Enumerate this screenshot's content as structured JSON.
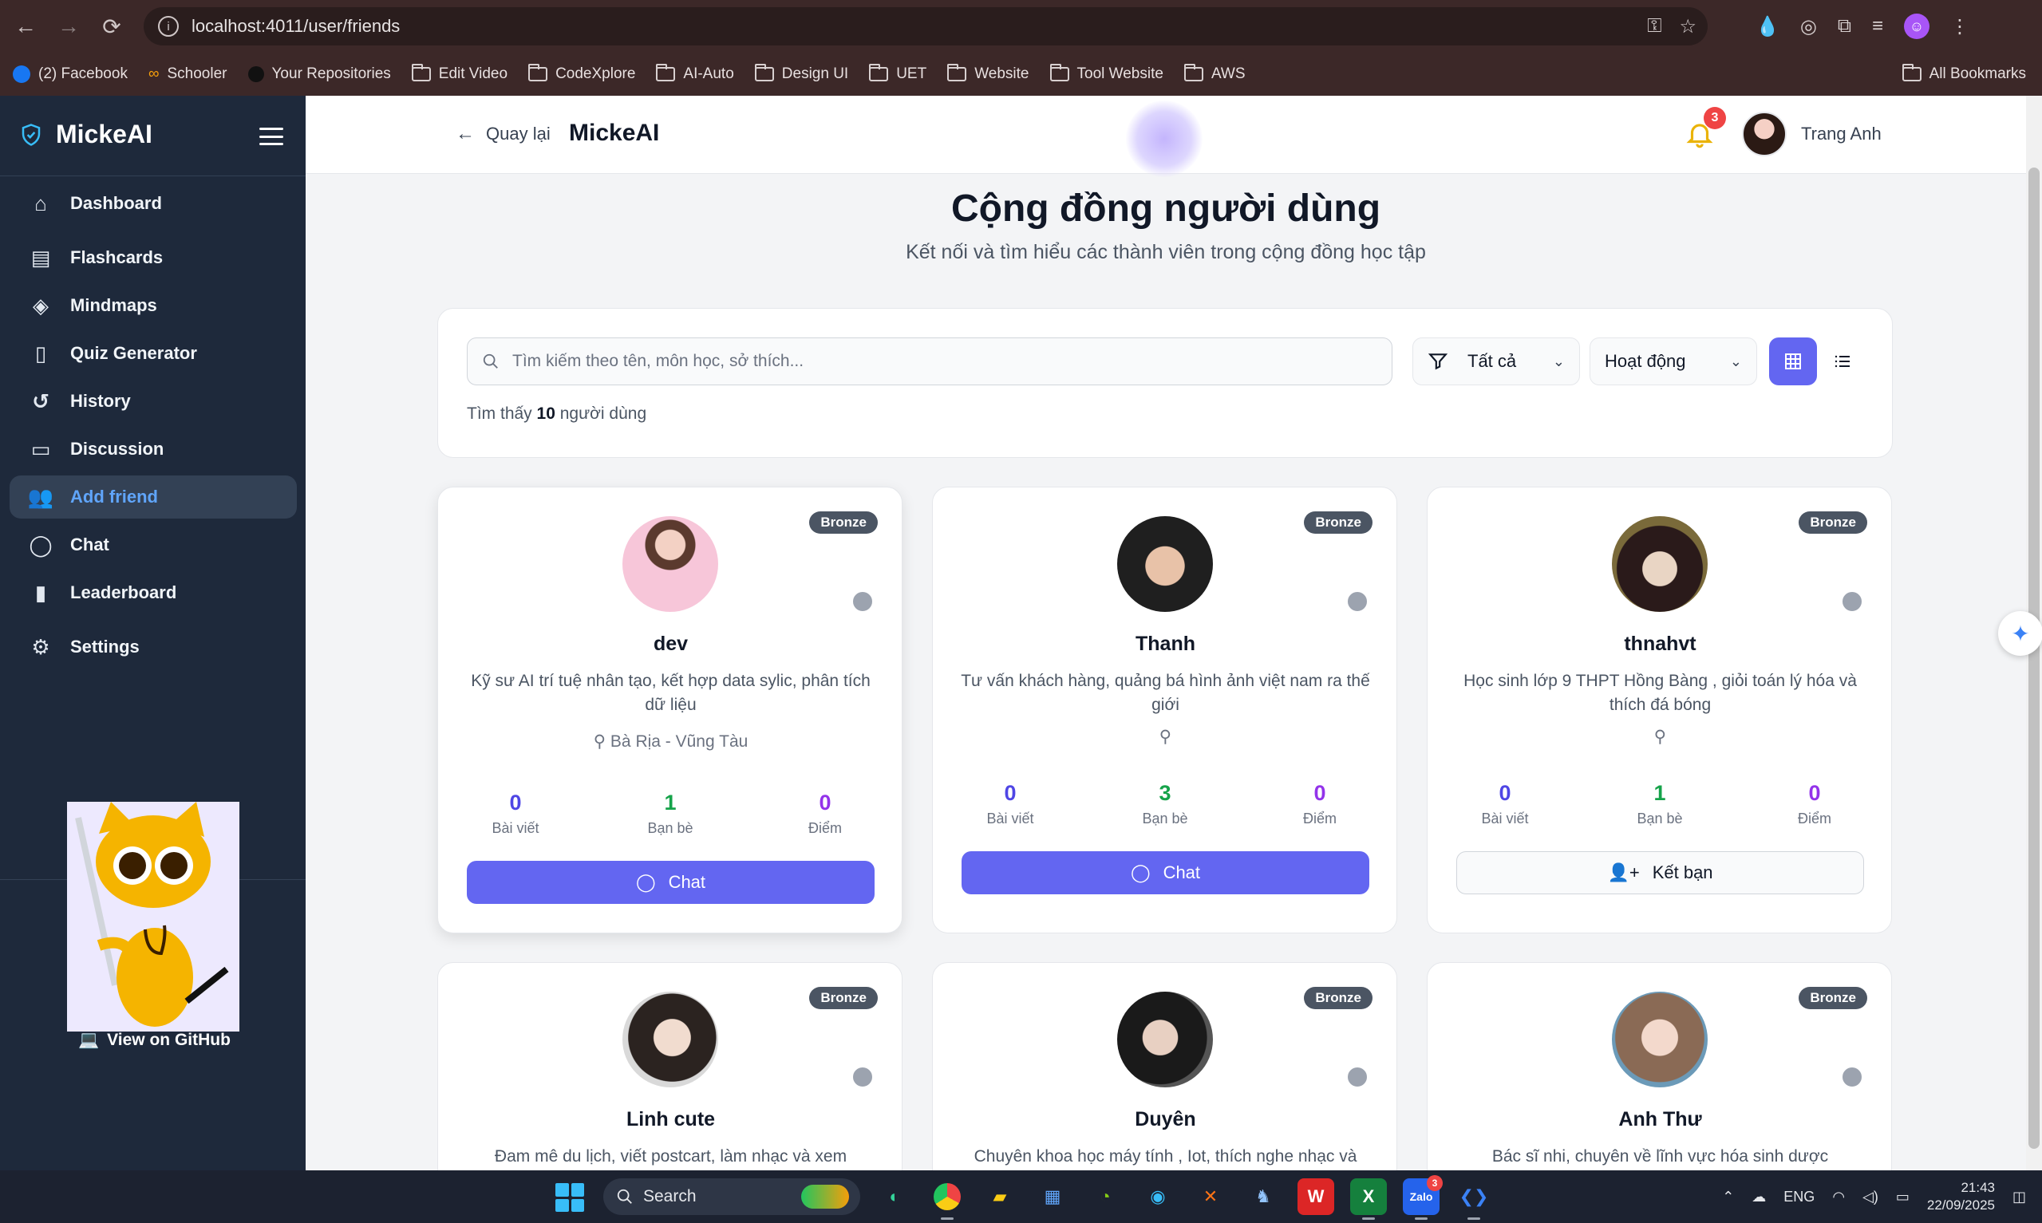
{
  "browser": {
    "url": "localhost:4011/user/friends",
    "bookmarks": [
      "(2) Facebook",
      "Schooler",
      "Your Repositories",
      "Edit Video",
      "CodeXplore",
      "AI-Auto",
      "Design UI",
      "UET",
      "Website",
      "Tool Website",
      "AWS"
    ],
    "all_bookmarks": "All Bookmarks"
  },
  "sidebar": {
    "brand": "MickeAI",
    "items": [
      {
        "label": "Dashboard",
        "icon": "home-icon"
      },
      {
        "label": "Flashcards",
        "icon": "clipboard-icon"
      },
      {
        "label": "Mindmaps",
        "icon": "layers-icon"
      },
      {
        "label": "Quiz Generator",
        "icon": "book-icon"
      },
      {
        "label": "History",
        "icon": "history-icon"
      },
      {
        "label": "Discussion",
        "icon": "message-square-icon"
      },
      {
        "label": "Add friend",
        "icon": "users-icon",
        "active": true
      },
      {
        "label": "Chat",
        "icon": "message-circle-icon"
      },
      {
        "label": "Leaderboard",
        "icon": "bar-chart-icon"
      },
      {
        "label": "Settings",
        "icon": "gear-icon"
      }
    ],
    "github": "View on GitHub"
  },
  "header": {
    "back_label": "Quay lại",
    "app_title": "MickeAI",
    "notifications": "3",
    "user_name": "Trang Anh"
  },
  "page": {
    "title": "Cộng đồng người dùng",
    "subtitle": "Kết nối và tìm hiểu các thành viên trong cộng đồng học tập"
  },
  "filters": {
    "search_placeholder": "Tìm kiếm theo tên, môn học, sở thích...",
    "category": "Tất cả",
    "sort": "Hoạt động",
    "count_prefix": "Tìm thấy",
    "count_value": "10",
    "count_suffix": "người dùng"
  },
  "users": [
    {
      "name": "dev",
      "tier": "Bronze",
      "bio": "Kỹ sư AI trí tuệ nhân tạo, kết hợp data sylic, phân tích dữ liệu",
      "location": "Bà Rịa - Vũng Tàu",
      "posts": "0",
      "friends": "1",
      "points": "0",
      "posts_label": "Bài viết",
      "friends_label": "Bạn bè",
      "points_label": "Điểm",
      "action": "Chat"
    },
    {
      "name": "Thanh",
      "tier": "Bronze",
      "bio": "Tư vấn khách hàng, quảng bá hình ảnh việt nam ra thế giới",
      "location": "",
      "posts": "0",
      "friends": "3",
      "points": "0",
      "posts_label": "Bài viết",
      "friends_label": "Bạn bè",
      "points_label": "Điểm",
      "action": "Chat"
    },
    {
      "name": "thnahvt",
      "tier": "Bronze",
      "bio": "Học sinh lớp 9 THPT Hồng Bàng , giỏi toán lý hóa và thích đá bóng",
      "location": "",
      "posts": "0",
      "friends": "1",
      "points": "0",
      "posts_label": "Bài viết",
      "friends_label": "Bạn bè",
      "points_label": "Điểm",
      "action": "Kết bạn"
    },
    {
      "name": "Linh cute",
      "tier": "Bronze",
      "bio": "Đam mê du lịch, viết postcart, làm nhạc và xem"
    },
    {
      "name": "Duyên",
      "tier": "Bronze",
      "bio": "Chuyên khoa học máy tính , Iot, thích nghe nhạc và"
    },
    {
      "name": "Anh Thư",
      "tier": "Bronze",
      "bio": "Bác sĩ nhi, chuyên về lĩnh vực hóa sinh dược"
    }
  ],
  "taskbar": {
    "search": "Search",
    "lang": "ENG",
    "time": "21:43",
    "date": "22/09/2025",
    "zalo_badge": "3"
  }
}
